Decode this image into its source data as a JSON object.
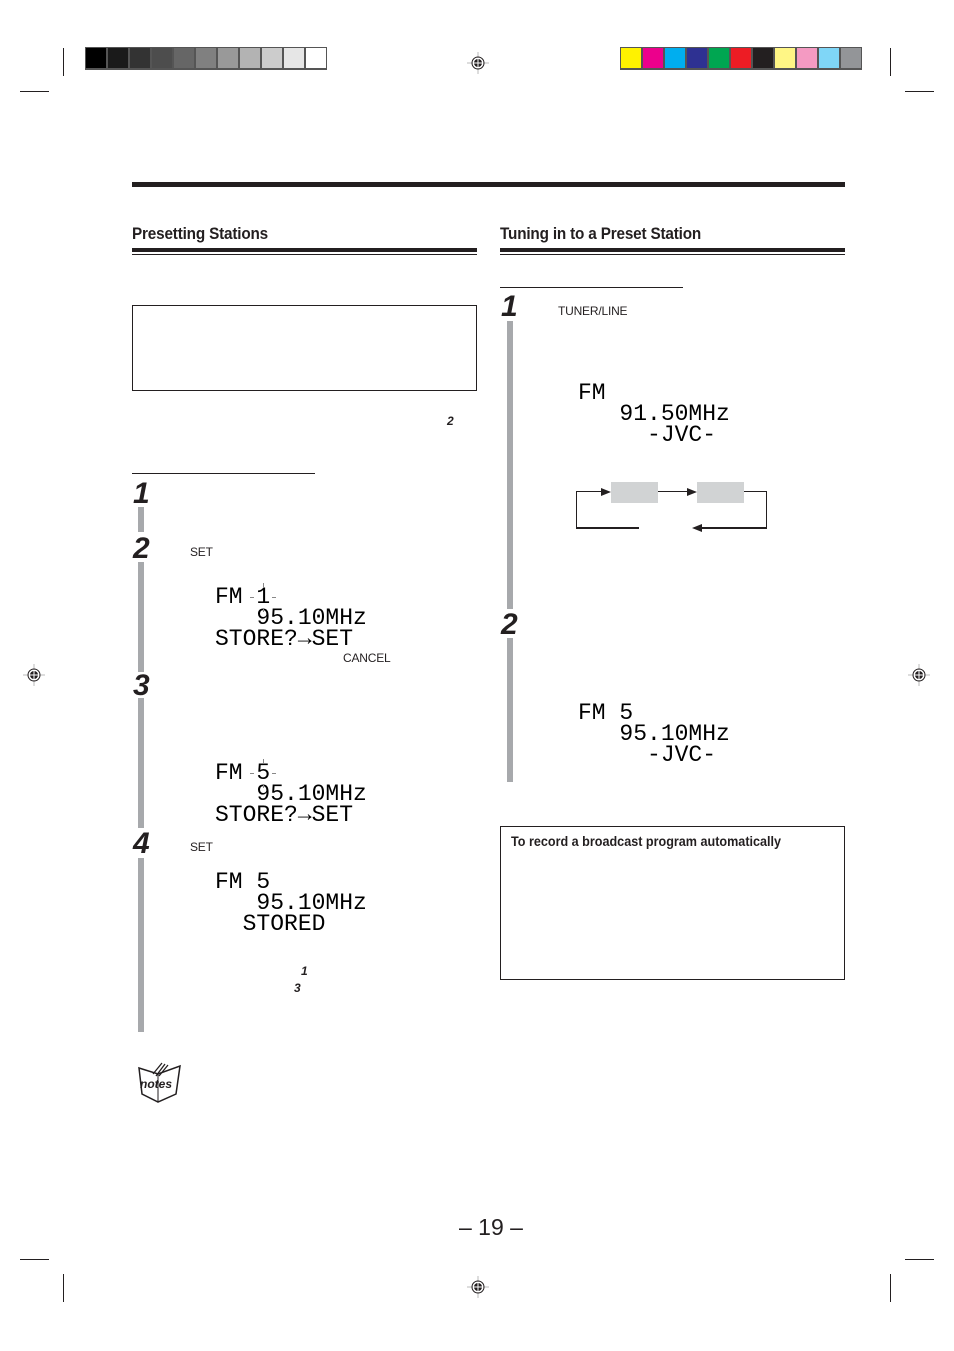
{
  "print_marks": {
    "grayscale_swatches": [
      "#000000",
      "#1a1a1a",
      "#333333",
      "#4d4d4d",
      "#666666",
      "#808080",
      "#999999",
      "#b3b3b3",
      "#cccccc",
      "#e6e6e6",
      "#ffffff"
    ],
    "color_swatches": [
      "#fff200",
      "#ec008c",
      "#00aeef",
      "#2e3192",
      "#00a651",
      "#ed1c24",
      "#231f20",
      "#fff685",
      "#f49ac2",
      "#7fd6f7",
      "#939598"
    ]
  },
  "left_section": {
    "title": "Presetting Stations",
    "ref_step": "2",
    "steps": [
      {
        "number": "1"
      },
      {
        "number": "2",
        "button_label": "SET",
        "display": {
          "band": "FM",
          "preset": "1",
          "frequency": "95.10MHz",
          "message": "STORE?→SET"
        },
        "cancel_label": "CANCEL"
      },
      {
        "number": "3",
        "display": {
          "band": "FM",
          "preset": "5",
          "frequency": "95.10MHz",
          "message": "STORE?→SET"
        }
      },
      {
        "number": "4",
        "button_label": "SET",
        "display": {
          "band": "FM",
          "preset": "5",
          "frequency": "95.10MHz",
          "message": "STORED"
        },
        "ref_1": "1",
        "ref_3": "3"
      }
    ],
    "notes_icon_label": "notes"
  },
  "right_section": {
    "title": "Tuning in to a Preset Station",
    "steps": [
      {
        "number": "1",
        "button_label": "TUNER/LINE",
        "display": {
          "band": "FM",
          "frequency": "91.50MHz",
          "station": "-JVC-"
        }
      },
      {
        "number": "2",
        "display": {
          "band": "FM",
          "preset": "5",
          "frequency": "95.10MHz",
          "station": "-JVC-"
        }
      }
    ],
    "record_box_title": "To record a broadcast program automatically"
  },
  "page_number": "– 19 –"
}
